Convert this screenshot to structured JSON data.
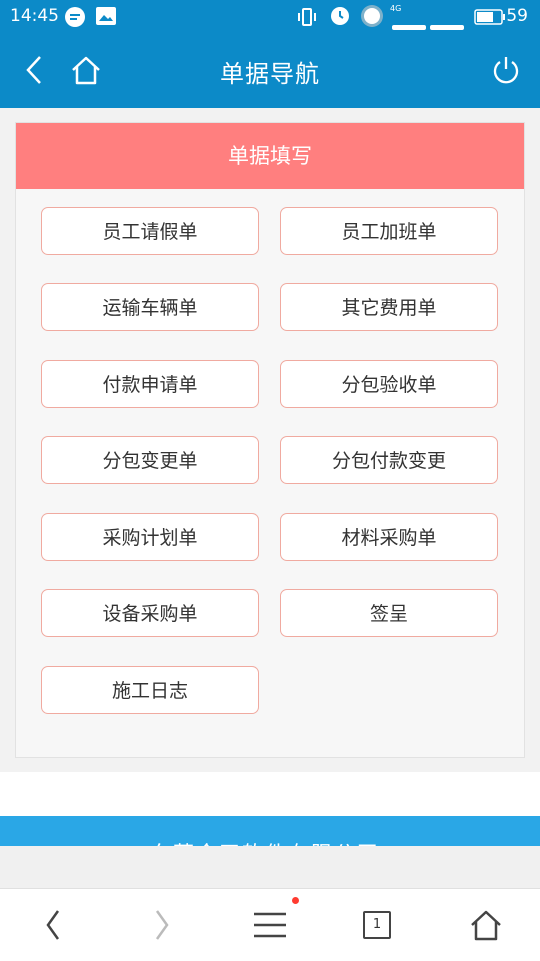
{
  "status": {
    "time": "14:45",
    "network": "4G",
    "battery": "59"
  },
  "nav": {
    "title": "单据导航"
  },
  "card": {
    "header": "单据填写",
    "buttons": [
      "员工请假单",
      "员工加班单",
      "运输车辆单",
      "其它费用单",
      "付款申请单",
      "分包验收单",
      "分包变更单",
      "分包付款变更",
      "采购计划单",
      "材料采购单",
      "设备采购单",
      "签呈",
      "施工日志"
    ]
  },
  "footer": {
    "company": "东莞今天软件有限公司"
  },
  "browser": {
    "tab_count": "1"
  },
  "colors": {
    "header_blue": "#0c8ac8",
    "card_header": "#ff7f7f",
    "button_border": "#f0aaa0",
    "footer_blue": "#2aa7e6"
  }
}
